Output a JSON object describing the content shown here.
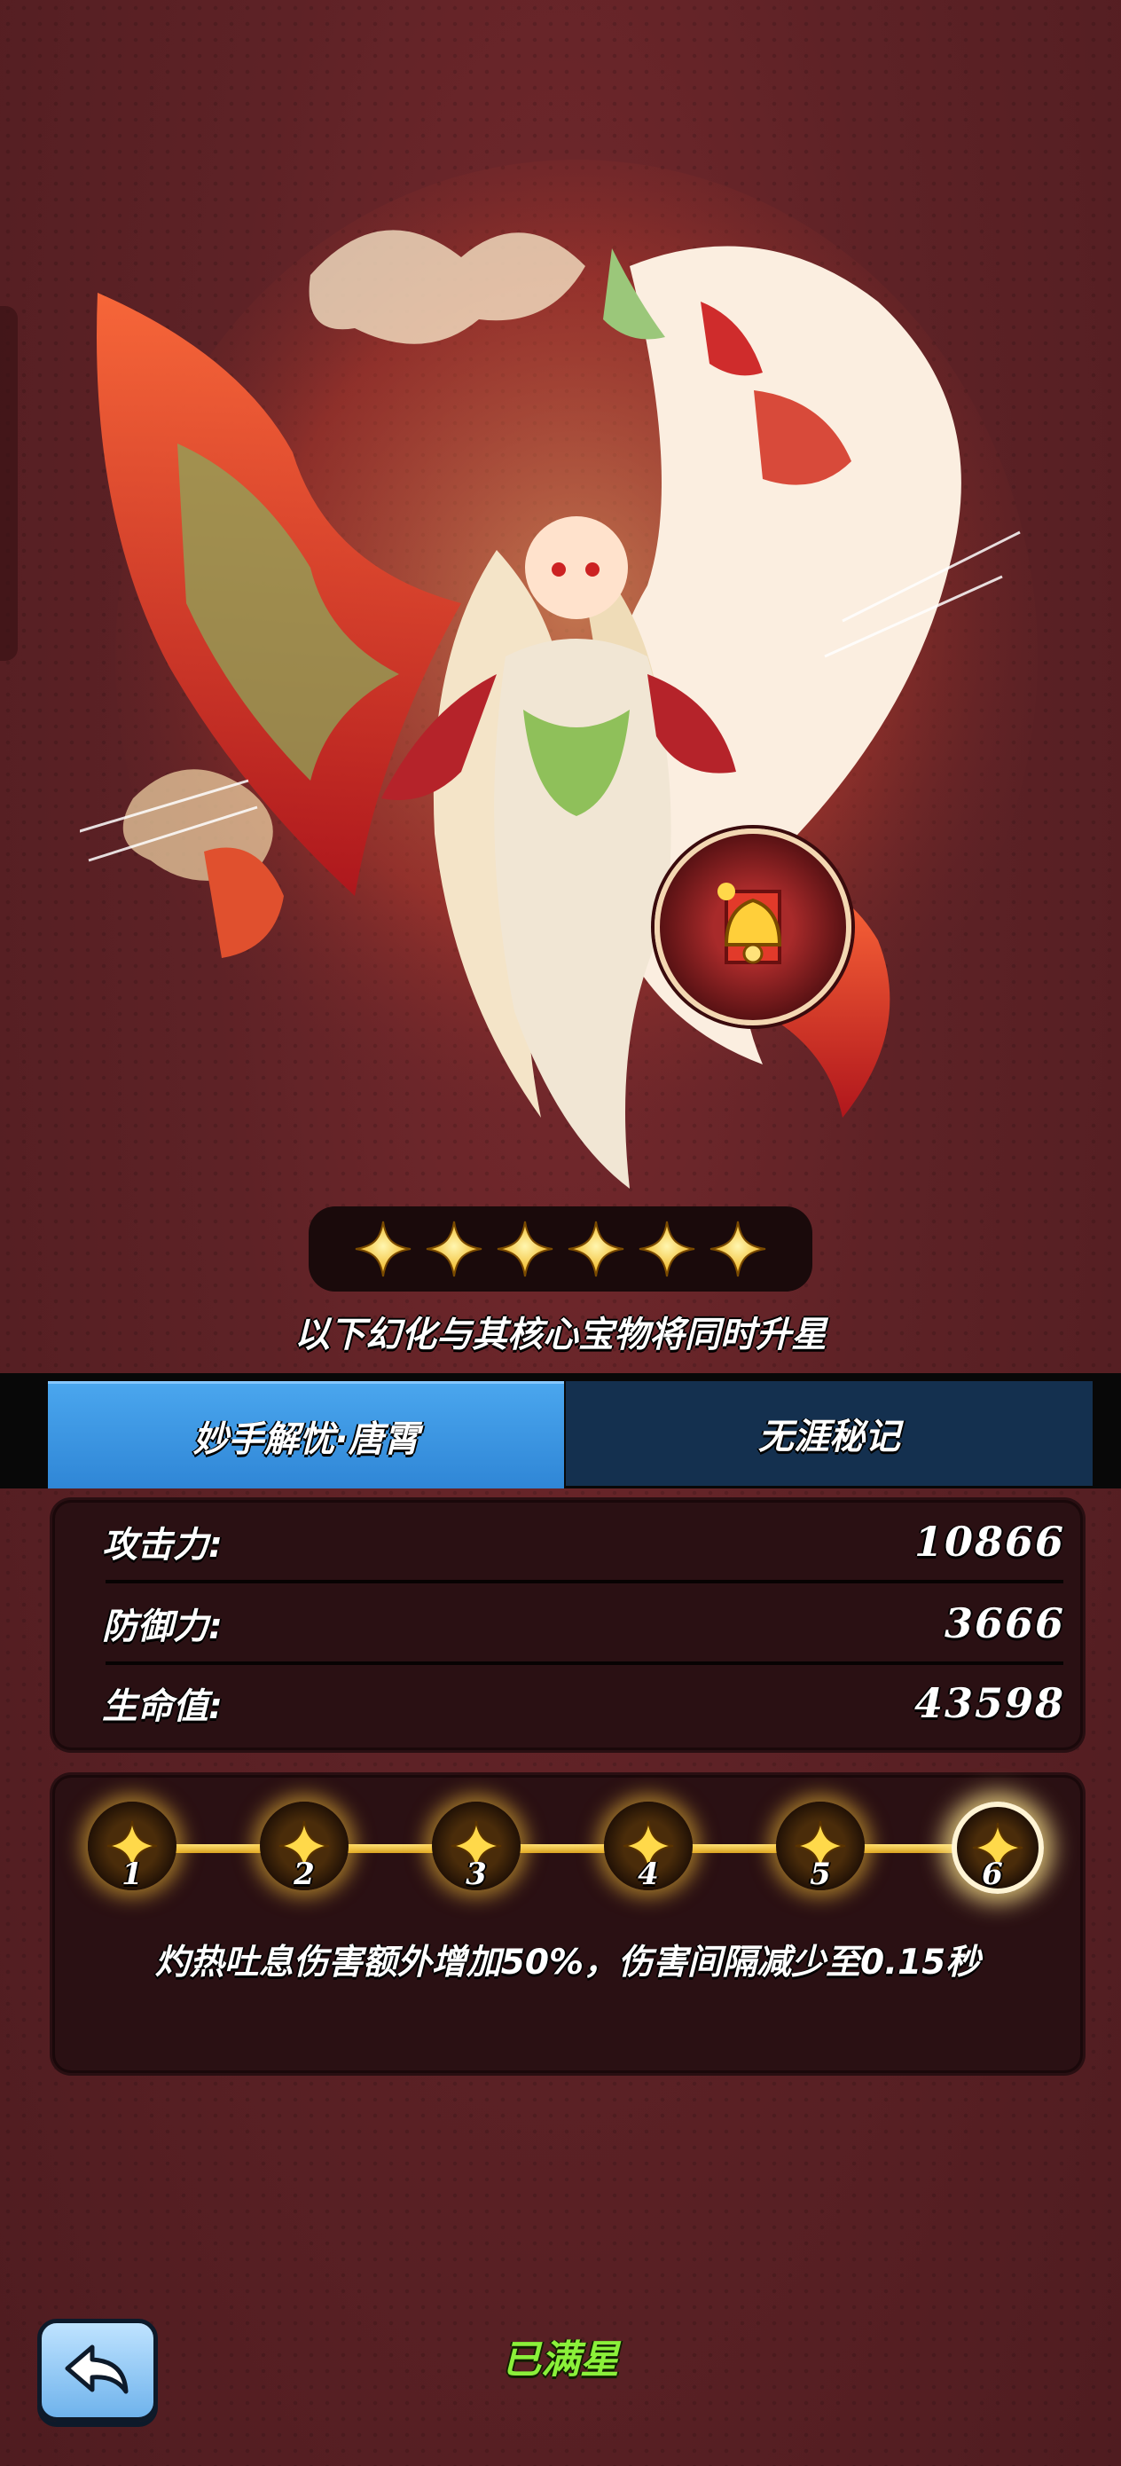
{
  "hero": {
    "art": "fox-spirit-hero-illustration",
    "treasure_icon": "bell-treasure-icon",
    "star_count": 6
  },
  "notice": "以下幻化与其核心宝物将同时升星",
  "tabs": [
    {
      "label": "妙手解忧·唐霄",
      "active": true
    },
    {
      "label": "无涯秘记",
      "active": false
    }
  ],
  "stats": [
    {
      "label": "攻击力:",
      "value": "10866"
    },
    {
      "label": "防御力:",
      "value": "3666"
    },
    {
      "label": "生命值:",
      "value": "43598"
    }
  ],
  "star_levels": {
    "levels": [
      "1",
      "2",
      "3",
      "4",
      "5",
      "6"
    ],
    "current_level": 6,
    "description": "灼热吐息伤害额外增加50%，伤害间隔减少至0.15秒"
  },
  "status": "已满星",
  "back_icon": "back-arrow-icon",
  "colors": {
    "accent_tab": "#3a93e3",
    "gold": "#ffd94a",
    "status_green": "#8bf03a"
  }
}
